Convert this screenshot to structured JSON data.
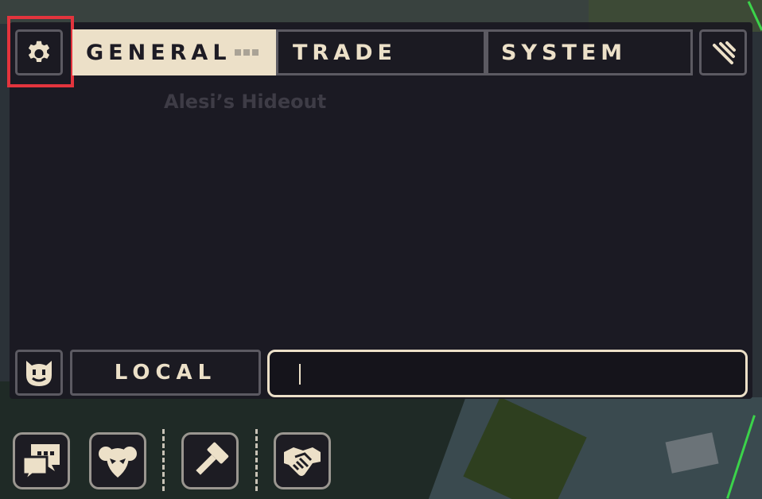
{
  "tabs": {
    "general": "GENERAL",
    "trade": "TRADE",
    "system": "SYSTEM",
    "active": "general"
  },
  "chat": {
    "location_text": "Alesi’s Hideout",
    "channel_label": "LOCAL",
    "input_value": "",
    "input_placeholder": ""
  },
  "icons": {
    "settings": "gear-icon",
    "collapse": "collapse-icon",
    "emote": "smiley-icon",
    "chat": "chat-bubbles-icon",
    "social": "mask-icon",
    "craft": "hammer-icon",
    "trade": "handshake-icon"
  },
  "colors": {
    "accent": "#ece0c8",
    "panel": "#1a1922",
    "highlight": "#e3343d",
    "border": "#5c5a62"
  }
}
